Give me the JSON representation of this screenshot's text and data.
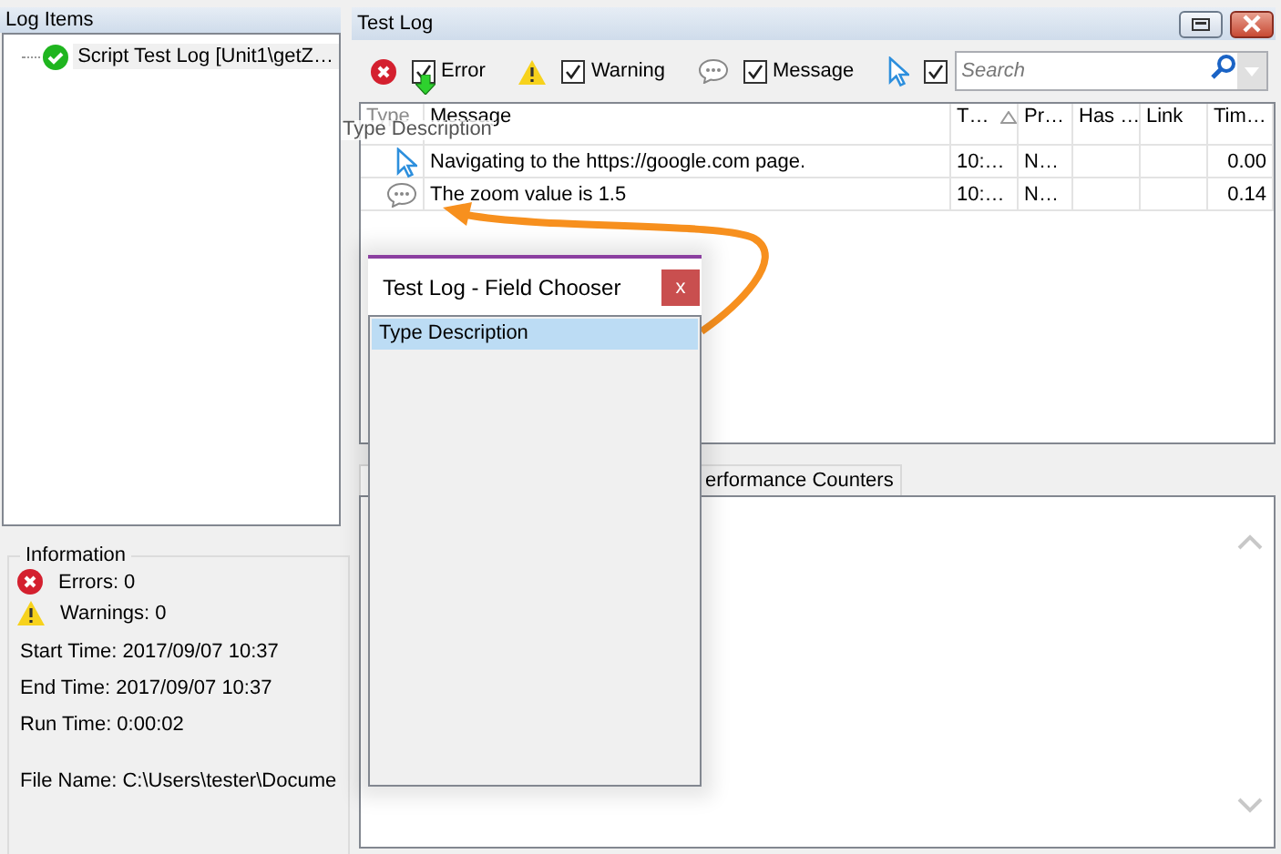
{
  "log_items": {
    "title": "Log Items",
    "items": [
      {
        "label": "Script Test Log [Unit1\\getZ…",
        "kind": "passed",
        "selected": true
      }
    ]
  },
  "information": {
    "title": "Information",
    "counts": [
      {
        "kind": "error",
        "label": "Errors: 0"
      },
      {
        "kind": "warning",
        "label": "Warnings: 0"
      }
    ],
    "lines": [
      "Start Time: 2017/09/07 10:37",
      "End Time: 2017/09/07 10:37",
      "Run Time: 0:00:02",
      "File Name: C:\\Users\\tester\\Docume"
    ]
  },
  "test_log": {
    "title": "Test Log",
    "filters": [
      {
        "kind": "error",
        "label": "Error",
        "checked": true
      },
      {
        "kind": "warning",
        "label": "Warning",
        "checked": true
      },
      {
        "kind": "message",
        "label": "Message",
        "checked": true
      },
      {
        "kind": "event",
        "checked": true
      }
    ],
    "search": {
      "placeholder": "Search"
    },
    "columns": [
      {
        "label": "Type",
        "sorted": false,
        "dragged": true
      },
      {
        "label": "Message",
        "sorted": false,
        "dragged": false
      },
      {
        "label": "T…",
        "sorted": true,
        "dragged": false
      },
      {
        "label": "Pr…",
        "sorted": false,
        "dragged": false
      },
      {
        "label": "Has …",
        "sorted": false,
        "dragged": false
      },
      {
        "label": "Link",
        "sorted": false,
        "dragged": false
      },
      {
        "label": "Tim…",
        "sorted": false,
        "dragged": false
      }
    ],
    "rows": [
      {
        "kind": "event",
        "message": "Navigating to the https://google.com page.",
        "time": "10:…",
        "priority": "N…",
        "time_diff": "0.00"
      },
      {
        "kind": "message",
        "message": "The zoom value is 1.5",
        "time": "10:…",
        "priority": "N…",
        "time_diff": "0.14"
      }
    ],
    "tabs": [
      {
        "selected": true
      },
      {
        "label": "erformance Counters",
        "selected": false
      }
    ]
  },
  "drag_ghost": {
    "label": "Type Description"
  },
  "field_chooser": {
    "title": "Test Log - Field Chooser",
    "close": "x",
    "items": [
      {
        "label": "Type Description",
        "selected": true
      }
    ]
  }
}
